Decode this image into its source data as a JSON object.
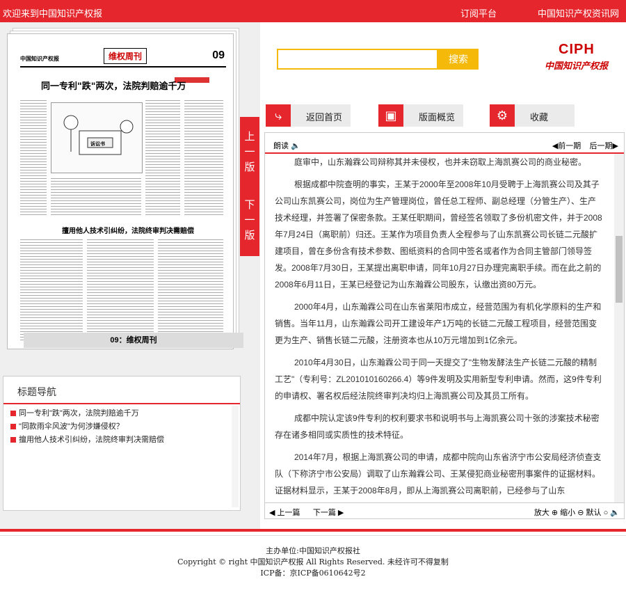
{
  "topbar": {
    "welcome": "欢迎来到中国知识产权报",
    "subscribe": "订阅平台",
    "news": "中国知识产权资讯网"
  },
  "paper": {
    "masthead_name": "中国知识产权报",
    "section": "维权周刊",
    "page": "09",
    "headline": "同一专利\"跌\"两次，法院判赔逾千万",
    "headline2": "擅用他人技术引纠纷，法院终审判决需赔偿",
    "cartoon_caption": "诉讼书"
  },
  "edition_label": "09：维权周刊",
  "version_tabs": {
    "prev": "上一版",
    "next": "下一版"
  },
  "navbox": {
    "title": "标题导航",
    "items": [
      "同一专利\"跌\"两次，法院判赔逾千万",
      "\"同款雨伞风波\"为何涉嫌侵权？",
      "擅用他人技术引纠纷，法院终审判决需赔偿"
    ]
  },
  "search": {
    "placeholder": "",
    "button": "搜索"
  },
  "logo": {
    "text": "CIPH",
    "cn": "中国知识产权报"
  },
  "toolbar": {
    "home": "返回首页",
    "overview": "版面概览",
    "favorite": "收藏"
  },
  "reader": {
    "read_label": "朗读",
    "prev_issue": "前一期",
    "next_issue": "后一期",
    "paragraphs": [
      "庭审中，山东瀚霖公司辩称其并未侵权，也并未窃取上海凯赛公司的商业秘密。",
      "根据成都中院查明的事实，王某于2000年至2008年10月受聘于上海凯赛公司及其子公司山东凯赛公司，岗位为生产管理岗位，曾任总工程师、副总经理（分管生产）、生产技术经理，并签署了保密条款。王某任职期间，曾经签名领取了多份机密文件，并于2008年7月24日（离职前）归还。王某作为项目负责人全程参与了山东凯赛公司长链二元酸扩建项目，曾在多份含有技术参数、图纸资料的合同中签名或者作为合同主管部门领导签发。2008年7月30日，王某提出离职申请，同年10月27日办理完离职手续。而在此之前的2008年6月11日，王某已经登记为山东瀚霖公司股东，认缴出资80万元。",
      "2000年4月，山东瀚霖公司在山东省莱阳市成立，经营范围为有机化学原料的生产和销售。当年11月，山东瀚霖公司开工建设年产1万吨的长链二元酸工程项目，经营范围变更为生产、销售长链二元酸，注册资本也从10万元增加到1亿余元。",
      "2010年4月30日，山东瀚霖公司于同一天提交了\"生物发酵法生产长链二元酸的精制工艺\"（专利号：ZL201010160266.4）等9件发明及实用新型专利申请。然而，这9件专利的申请权、署名权后经法院终审判决均归上海凯赛公司及其员工所有。",
      "成都中院认定该9件专利的权利要求书和说明书与上海凯赛公司十张的涉案技术秘密存在诸多相同或实质性的技术特征。",
      "2014年7月，根据上海凯赛公司的申请，成都中院向山东省济宁市公安局经济侦查支队（下称济宁市公安局）调取了山东瀚霖公司、王某侵犯商业秘密刑事案件的证据材料。证据材料显示，王某于2008年8月，即从上海凯赛公司离职前，已经参与了山东"
    ],
    "prev_article": "上一篇",
    "next_article": "下一篇",
    "zoom_in": "放大",
    "zoom_out": "缩小",
    "default": "默认"
  },
  "footer": {
    "line1": "主办单位:中国知识产权报社",
    "line2": "Copyright © right 中国知识产权报 All Rights Reserved. 未经许可不得复制",
    "line3": "ICP备：京ICP备0610642号2"
  }
}
